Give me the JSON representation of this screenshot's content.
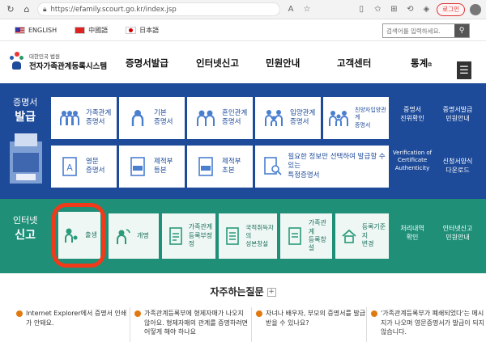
{
  "browser": {
    "url": "https://efamily.scourt.go.kr/index.jsp",
    "login_label": "로그인"
  },
  "langbar": {
    "languages": [
      {
        "label": "ENGLISH",
        "flag": "us"
      },
      {
        "label": "中國語",
        "flag": "cn"
      },
      {
        "label": "日本語",
        "flag": "jp"
      }
    ],
    "search_placeholder": "검색어를 입력하세요."
  },
  "header": {
    "logo_small": "대한민국 법원",
    "logo_big": "전자가족관계등록시스템",
    "nav": [
      "증명서발급",
      "인터넷신고",
      "민원안내",
      "고객센터",
      "통계"
    ],
    "stats_ext_icon": "⧉"
  },
  "cert": {
    "title_line1": "증명서",
    "title_line2": "발급",
    "tiles": [
      {
        "label": "가족관계\n증명서",
        "icon": "family-icon"
      },
      {
        "label": "기본\n증명서",
        "icon": "person-icon"
      },
      {
        "label": "혼인관계\n증명서",
        "icon": "couple-icon"
      },
      {
        "label": "입양관계\n증명서",
        "icon": "adoption-icon"
      },
      {
        "label": "친양자입양관계\n증명서",
        "icon": "family-group-icon"
      },
      {
        "label": "영문\n증명서",
        "icon": "english-doc-icon"
      },
      {
        "label": "제적부\n등본",
        "icon": "register-icon"
      },
      {
        "label": "제적부\n초본",
        "icon": "register-icon"
      },
      {
        "label": "필요한 정보만 선택하여 발급할 수 있는\n특정증명서",
        "icon": "search-doc-icon"
      }
    ],
    "side_links": [
      {
        "label": "증명서\n진위확인"
      },
      {
        "label": "증명서발급\n민원안내"
      },
      {
        "label": "Verification of\nCertificate\nAuthenticity"
      },
      {
        "label": "신청서양식\n다운로드"
      }
    ]
  },
  "report": {
    "title_line1": "인터넷",
    "title_line2": "신고",
    "tiles": [
      {
        "label": "출생",
        "icon": "birth-icon"
      },
      {
        "label": "개명",
        "icon": "rename-icon"
      },
      {
        "label": "가족관계\n등록부정정",
        "icon": "correction-doc-icon"
      },
      {
        "label": "국적취득자의\n성본창설",
        "icon": "nationality-doc-icon"
      },
      {
        "label": "가족관계\n등록창설",
        "icon": "create-doc-icon"
      },
      {
        "label": "등록기준지\n변경",
        "icon": "house-icon"
      }
    ],
    "side_links": [
      {
        "label": "처리내역\n확인"
      },
      {
        "label": "인터넷신고\n민원안내"
      }
    ]
  },
  "faq": {
    "title": "자주하는질문",
    "plus": "+",
    "items": [
      "Internet Explorer에서 증명서 인쇄가 안돼요.",
      "가족관계등록부에 형제자매가 나오지 않아요. 형제자매의 관계를 증명하려면 어떻게 해야 하나요",
      "자녀나 배우자, 부모의 증명서를 발급받을 수 있나요?",
      "'가족관계등록부가 폐쇄되었다'는 메시지가 나오며 영문증명서가 발급이 되지 않습니다."
    ]
  },
  "colors": {
    "cert_bg": "#1d4a99",
    "report_bg": "#1f8f78",
    "highlight": "#f03a1a"
  }
}
